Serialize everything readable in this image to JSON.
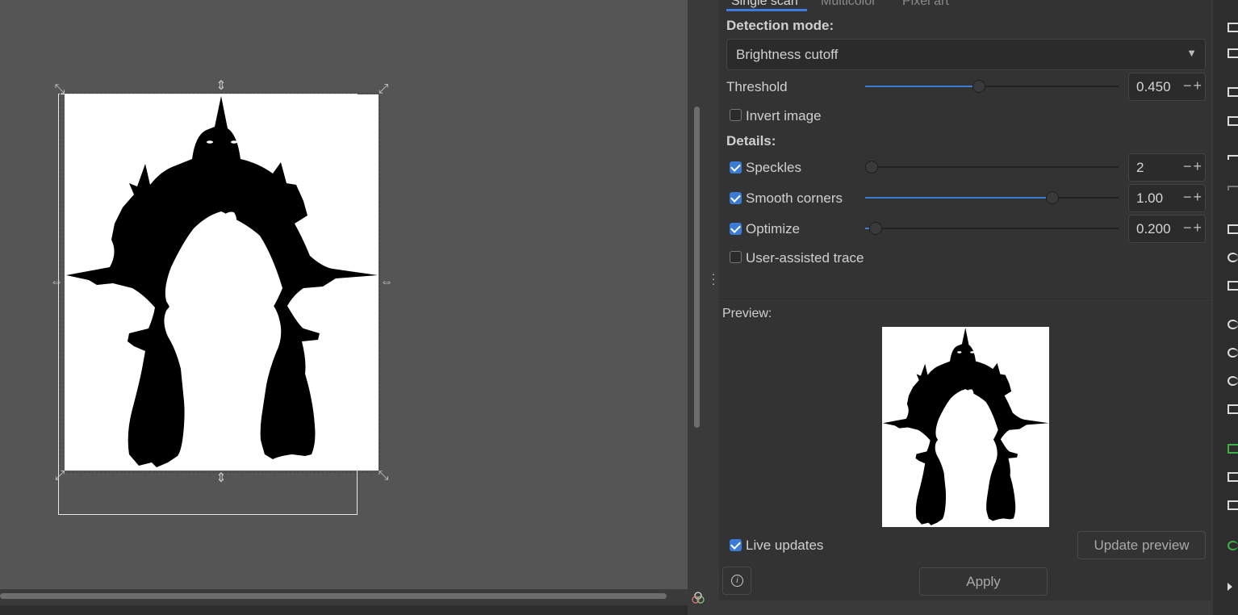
{
  "tabs": [
    {
      "label": "Single scan",
      "active": true
    },
    {
      "label": "Multicolor",
      "active": false
    },
    {
      "label": "Pixel art",
      "active": false
    }
  ],
  "detection": {
    "heading": "Detection mode:",
    "mode_value": "Brightness cutoff"
  },
  "threshold": {
    "label": "Threshold",
    "value": "0.450",
    "level": 0.45
  },
  "invert": {
    "label": "Invert image",
    "checked": false
  },
  "details": {
    "heading": "Details:",
    "speckles": {
      "label": "Speckles",
      "value": "2",
      "checked": true,
      "level": 0.0
    },
    "smooth": {
      "label": "Smooth corners",
      "value": "1.00",
      "checked": true,
      "level": 0.74
    },
    "optimize": {
      "label": "Optimize",
      "value": "0.200",
      "checked": true,
      "level": 0.04
    },
    "assisted": {
      "label": "User-assisted trace",
      "checked": false
    }
  },
  "preview": {
    "label": "Preview:"
  },
  "live_updates": {
    "label": "Live updates",
    "checked": true
  },
  "buttons": {
    "update_preview": "Update preview",
    "apply": "Apply",
    "info": "i"
  },
  "spin_symbols": "−+",
  "colors": {
    "accent": "#3a7bd5",
    "panel": "#333333",
    "canvas": "#555555"
  }
}
